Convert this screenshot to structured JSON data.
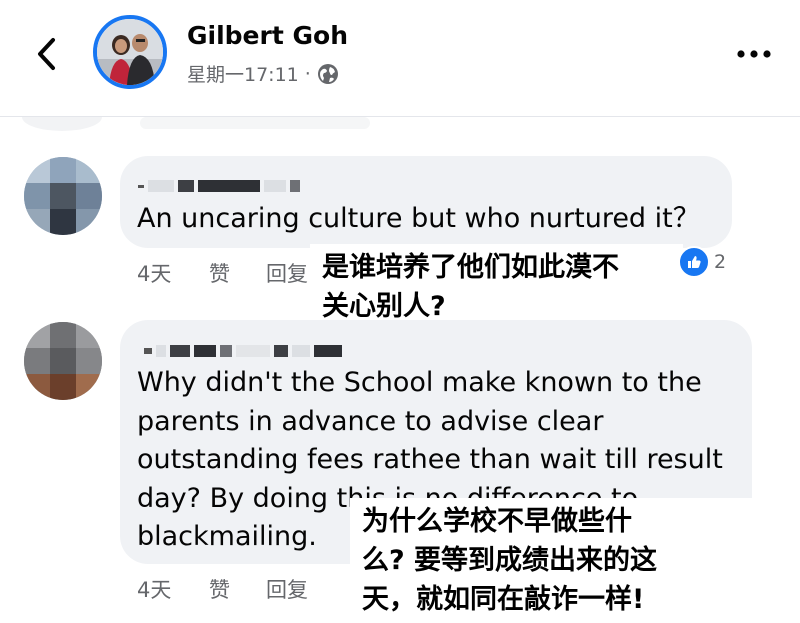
{
  "header": {
    "poster_name": "Gilbert Goh",
    "post_time": "星期一17:11",
    "separator": "·",
    "back_icon": "chevron-left-icon",
    "audience_icon": "globe-icon",
    "more_icon": "ellipsis-icon"
  },
  "comments": [
    {
      "text_lines": [
        "An uncaring culture but who nurtured it？"
      ],
      "time": "4天",
      "like": "赞",
      "reply": "回复",
      "reaction_icon": "like-icon",
      "reaction_count": "2",
      "translation_lines": [
        "是谁培养了他们如此漠不",
        "关心别人?"
      ]
    },
    {
      "text_lines": [
        "Why didn't the School make known to the",
        "parents in advance to advise clear",
        "outstanding fees rathee than wait till result",
        "day? By doing this is no difference to",
        "blackmailing."
      ],
      "time": "4天",
      "like": "赞",
      "reply": "回复",
      "translation_lines": [
        "为什么学校不早做些什",
        "么? 要等到成绩出来的这",
        "天，就如同在敲诈一样!"
      ]
    }
  ],
  "colors": {
    "accent": "#1877f2",
    "bubble": "#f0f2f5",
    "muted_text": "#65676b"
  }
}
